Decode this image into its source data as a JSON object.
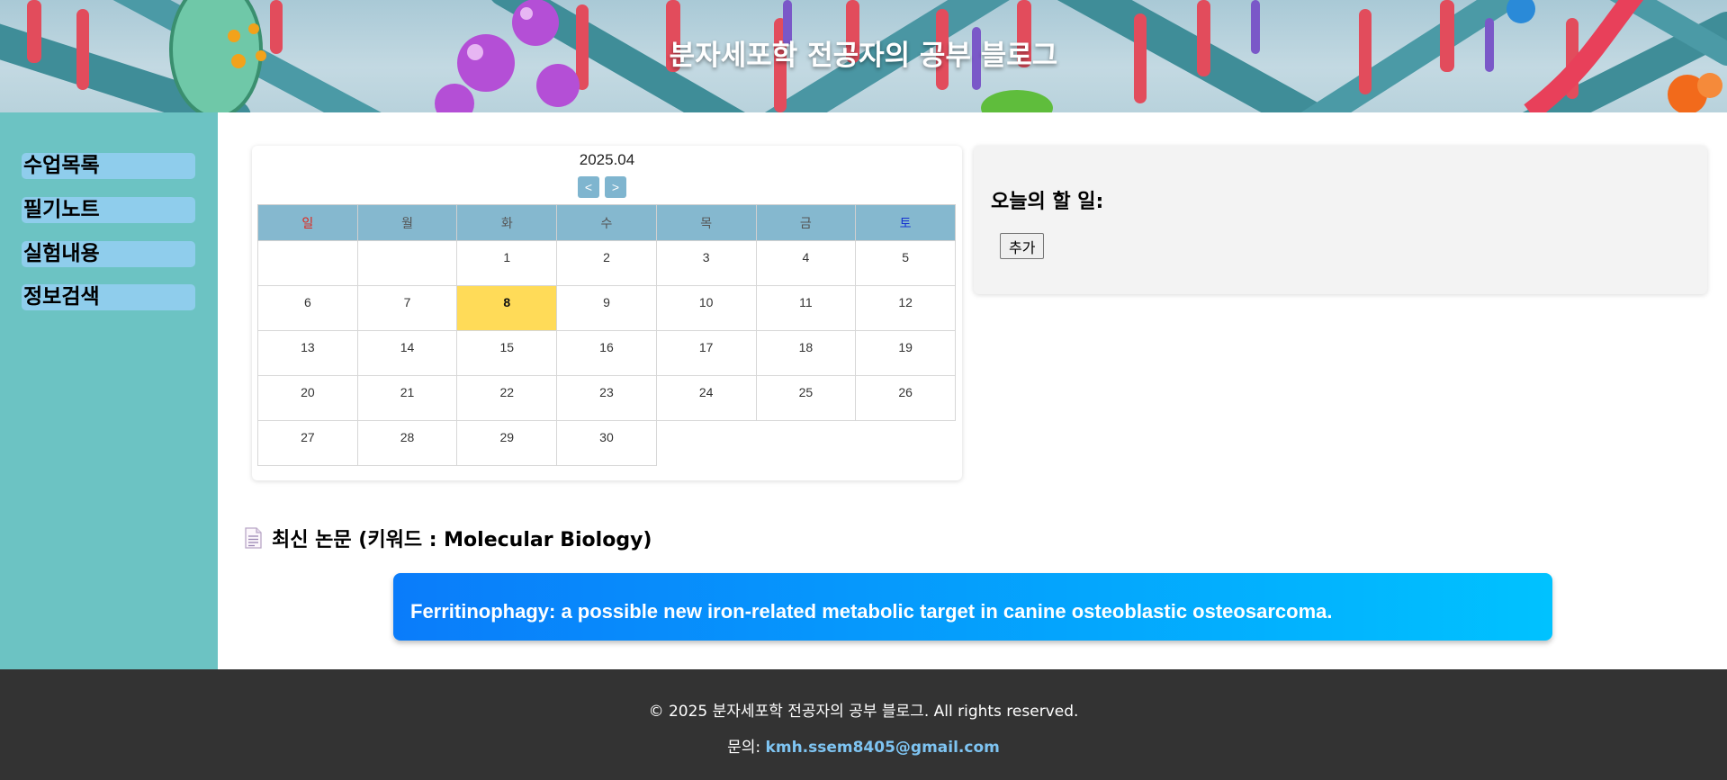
{
  "site": {
    "title": "분자세포학 전공자의 공부 블로그"
  },
  "sidebar": {
    "items": [
      {
        "label": "수업목록"
      },
      {
        "label": "필기노트"
      },
      {
        "label": "실험내용"
      },
      {
        "label": "정보검색"
      }
    ]
  },
  "calendar": {
    "month_label": "2025.04",
    "prev_label": "<",
    "next_label": ">",
    "weekdays": [
      "일",
      "월",
      "화",
      "수",
      "목",
      "금",
      "토"
    ],
    "today": 8,
    "weeks": [
      [
        "",
        "",
        "1",
        "2",
        "3",
        "4",
        "5"
      ],
      [
        "6",
        "7",
        "8",
        "9",
        "10",
        "11",
        "12"
      ],
      [
        "13",
        "14",
        "15",
        "16",
        "17",
        "18",
        "19"
      ],
      [
        "20",
        "21",
        "22",
        "23",
        "24",
        "25",
        "26"
      ],
      [
        "27",
        "28",
        "29",
        "30",
        "",
        "",
        ""
      ]
    ],
    "colors": {
      "sunday": "#e0261b",
      "saturday": "#1633d1",
      "today": "#ffdb58",
      "header": "#85b8cf"
    }
  },
  "todo": {
    "title": "오늘의 할 일:",
    "add_label": "추가"
  },
  "papers": {
    "heading": "최신 논문 (키워드 : Molecular Biology)",
    "items": [
      {
        "title": "Ferritinophagy: a possible new iron-related metabolic target in canine osteoblastic osteosarcoma."
      }
    ]
  },
  "footer": {
    "copyright": "© 2025 분자세포학 전공자의 공부 블로그. All rights reserved.",
    "contact_label": "문의: ",
    "email": "kmh.ssem8405@gmail.com"
  },
  "icons": {
    "papers_heading": "document-icon"
  }
}
